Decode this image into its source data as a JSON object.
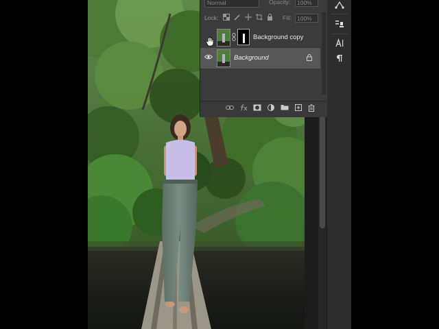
{
  "layers_panel": {
    "blend_mode": "Normal",
    "opacity_label": "Opacity:",
    "opacity_value": "100%",
    "lock_label": "Lock:",
    "fill_label": "Fill:",
    "fill_value": "100%",
    "layers": [
      {
        "name": "Background copy",
        "visible": false,
        "has_mask": true,
        "locked": false,
        "selected": false
      },
      {
        "name": "Background",
        "visible": true,
        "has_mask": false,
        "locked": true,
        "selected": true
      }
    ],
    "footer_icons": [
      "link-icon",
      "fx-icon",
      "mask-icon",
      "adjustment-icon",
      "folder-icon",
      "new-layer-icon",
      "trash-icon"
    ]
  },
  "right_toolbar": {
    "icons": [
      "path-select-icon",
      "properties-icon",
      "character-icon",
      "paragraph-icon"
    ]
  },
  "colors": {
    "panel_bg": "#3b3b3b",
    "selected_layer_bg": "#575757",
    "workspace_bg": "#1c1c1c"
  }
}
